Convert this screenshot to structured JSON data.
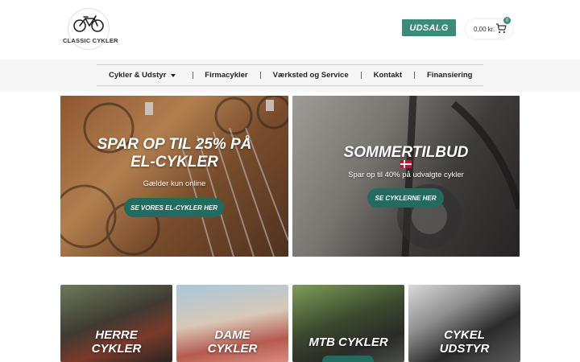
{
  "brand": {
    "logo_text": "CLASSIC CYKLER"
  },
  "header": {
    "sale_label": "UDSALG",
    "cart_total": "0,00 kr.",
    "cart_count": "0"
  },
  "nav": {
    "items": [
      {
        "label": "Cykler & Udstyr",
        "has_dropdown": true
      },
      {
        "label": "Firmacykler"
      },
      {
        "label": "Værksted og Service"
      },
      {
        "label": "Kontakt"
      },
      {
        "label": "Finansiering"
      }
    ]
  },
  "heroes": [
    {
      "title_line1": "SPAR OP TIL 25% PÅ",
      "title_line2": "EL-CYKLER",
      "subtitle": "Gælder kun online",
      "button": "SE VORES EL-CYKLER HER"
    },
    {
      "title": "SOMMERTILBUD",
      "subtitle": "Spar op til 40% på udvalgte cykler",
      "button": "SE CYKLERNE HER"
    }
  ],
  "categories": [
    {
      "line1": "HERRE",
      "line2": "CYKLER"
    },
    {
      "line1": "DAME",
      "line2": "CYKLER"
    },
    {
      "line1": "MTB CYKLER",
      "line2": ""
    },
    {
      "line1": "CYKEL",
      "line2": "UDSTYR"
    }
  ],
  "colors": {
    "accent": "#3c8a78",
    "button_dark": "#216b5f",
    "nav_band": "#f6f6f6"
  },
  "icons": [
    "bicycle-logo-icon",
    "cart-icon",
    "chevron-down-icon",
    "danish-flag-icon"
  ]
}
